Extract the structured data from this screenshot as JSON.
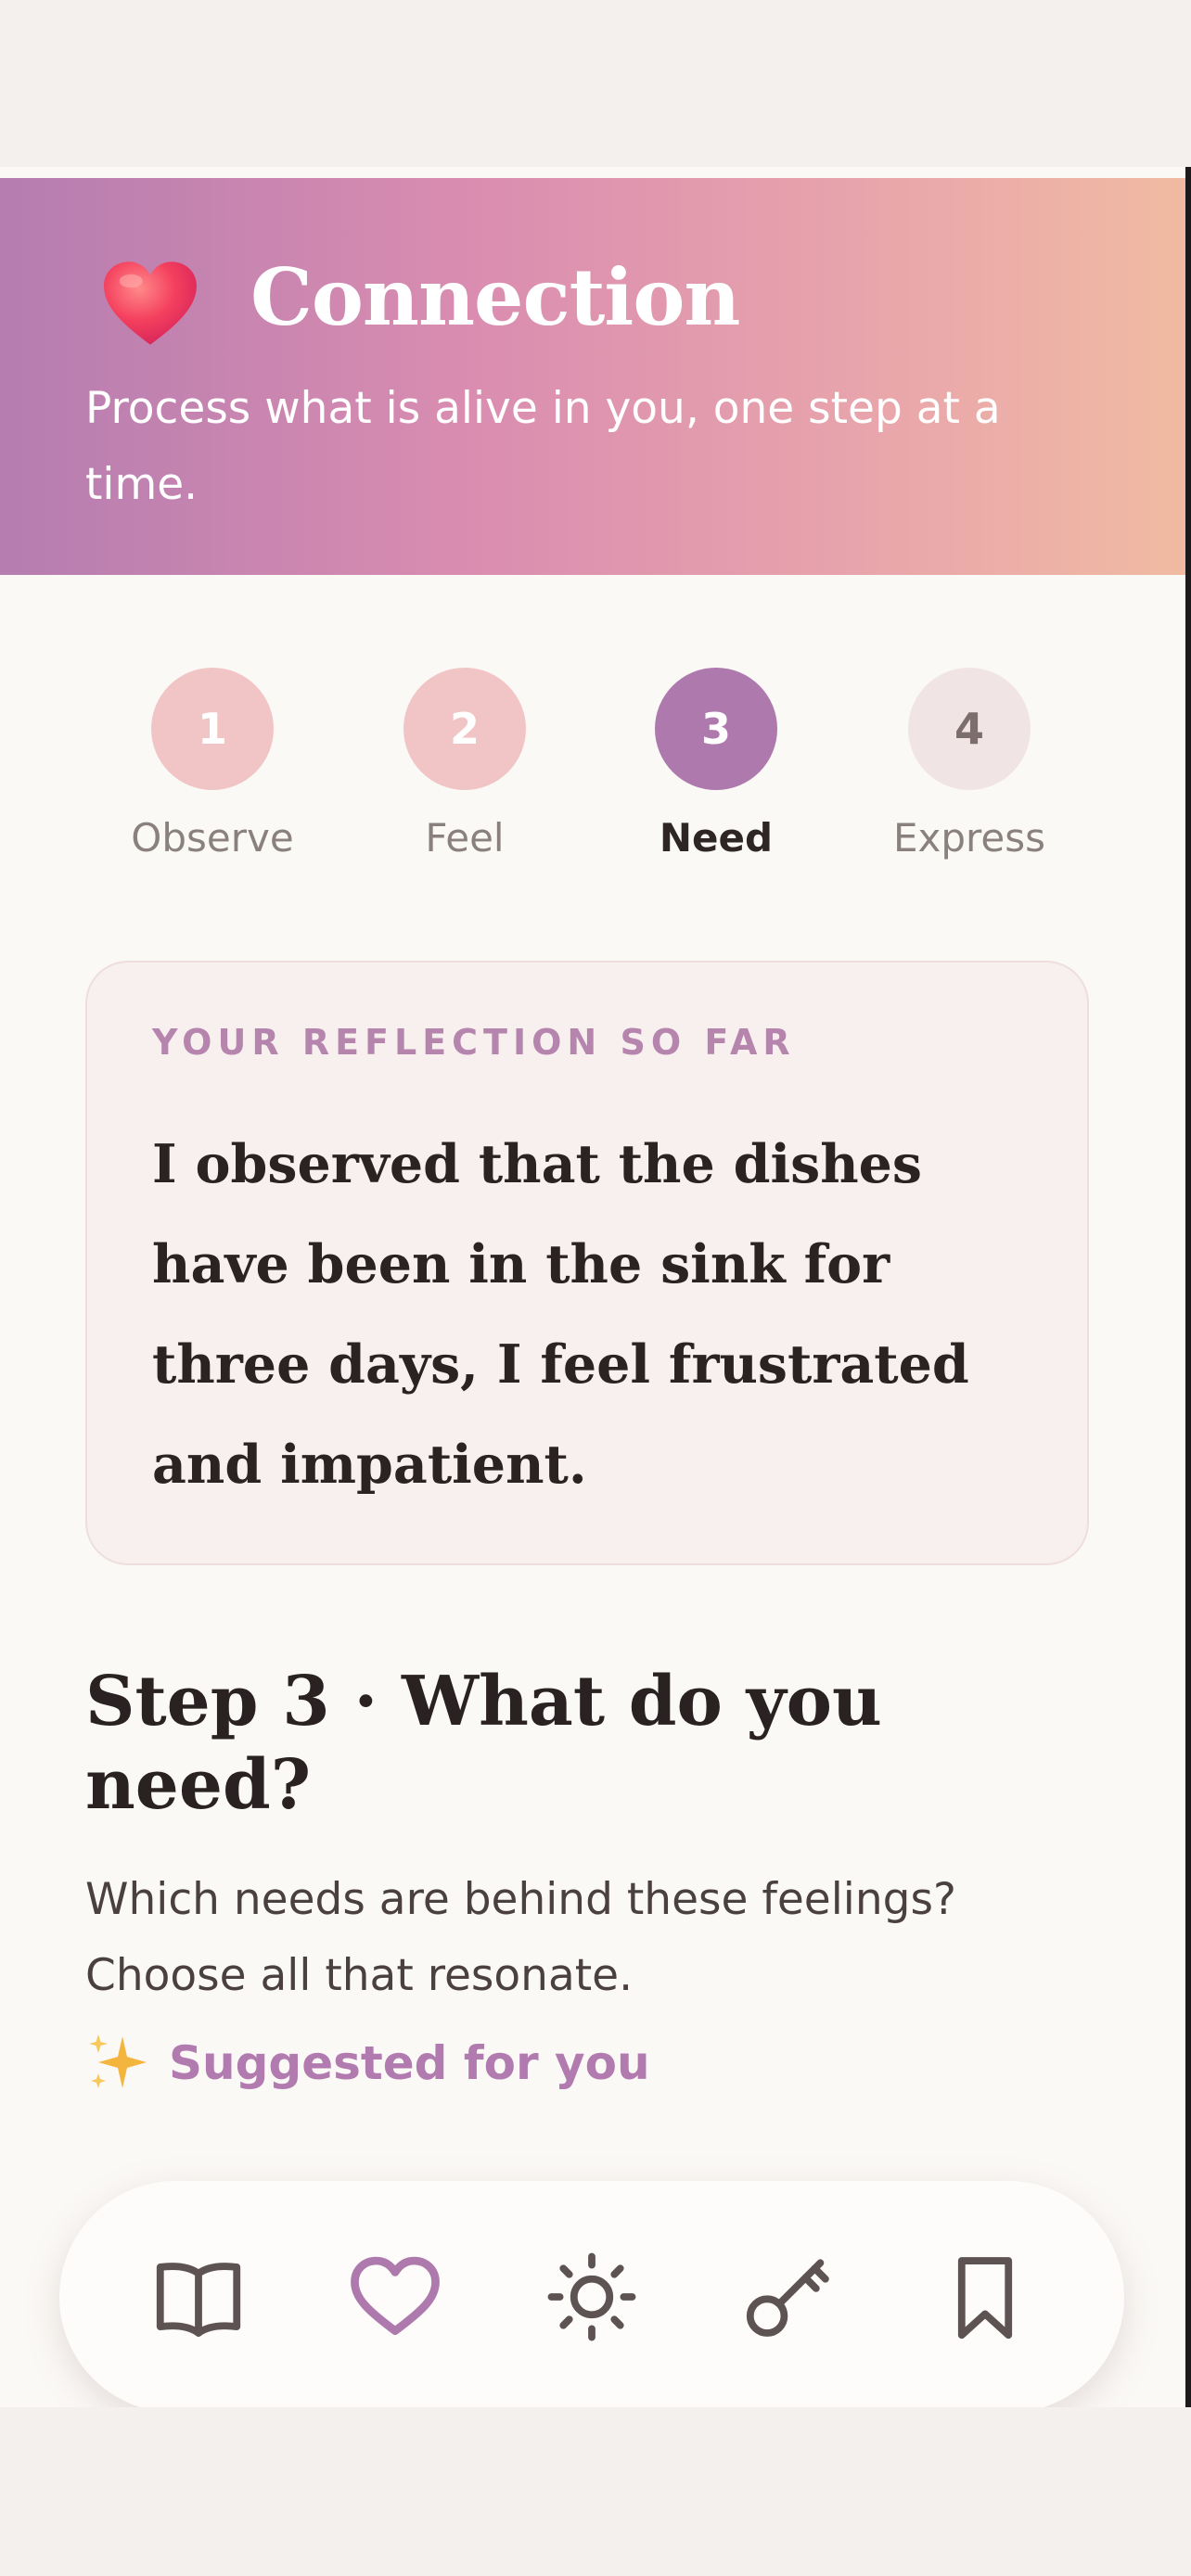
{
  "header": {
    "title": "Connection",
    "subtitle": "Process what is alive in you, one step at a time.",
    "icon": "heart-icon"
  },
  "steps": [
    {
      "number": "1",
      "label": "Observe",
      "state": "done"
    },
    {
      "number": "2",
      "label": "Feel",
      "state": "done"
    },
    {
      "number": "3",
      "label": "Need",
      "state": "active"
    },
    {
      "number": "4",
      "label": "Express",
      "state": "todo"
    }
  ],
  "reflection": {
    "label": "YOUR REFLECTION SO FAR",
    "text": "I observed that the dishes have been in the sink for three days, I feel frustrated and impatient."
  },
  "current_step": {
    "heading": "Step 3 · What do you need?",
    "description": "Which needs are behind these feelings? Choose all that resonate."
  },
  "suggested": {
    "label": "Suggested for you",
    "icon": "sparkle-icon"
  },
  "nav": {
    "items": [
      {
        "icon": "book-icon",
        "active": false
      },
      {
        "icon": "heart-outline-icon",
        "active": true
      },
      {
        "icon": "sun-icon",
        "active": false
      },
      {
        "icon": "key-icon",
        "active": false
      },
      {
        "icon": "bookmark-icon",
        "active": false
      }
    ]
  },
  "colors": {
    "accent": "#ae79ad",
    "gradient_start": "#b57db0",
    "gradient_end": "#f0bba2",
    "step_done": "#f1c5c5",
    "step_todo": "#f0e5e4"
  }
}
